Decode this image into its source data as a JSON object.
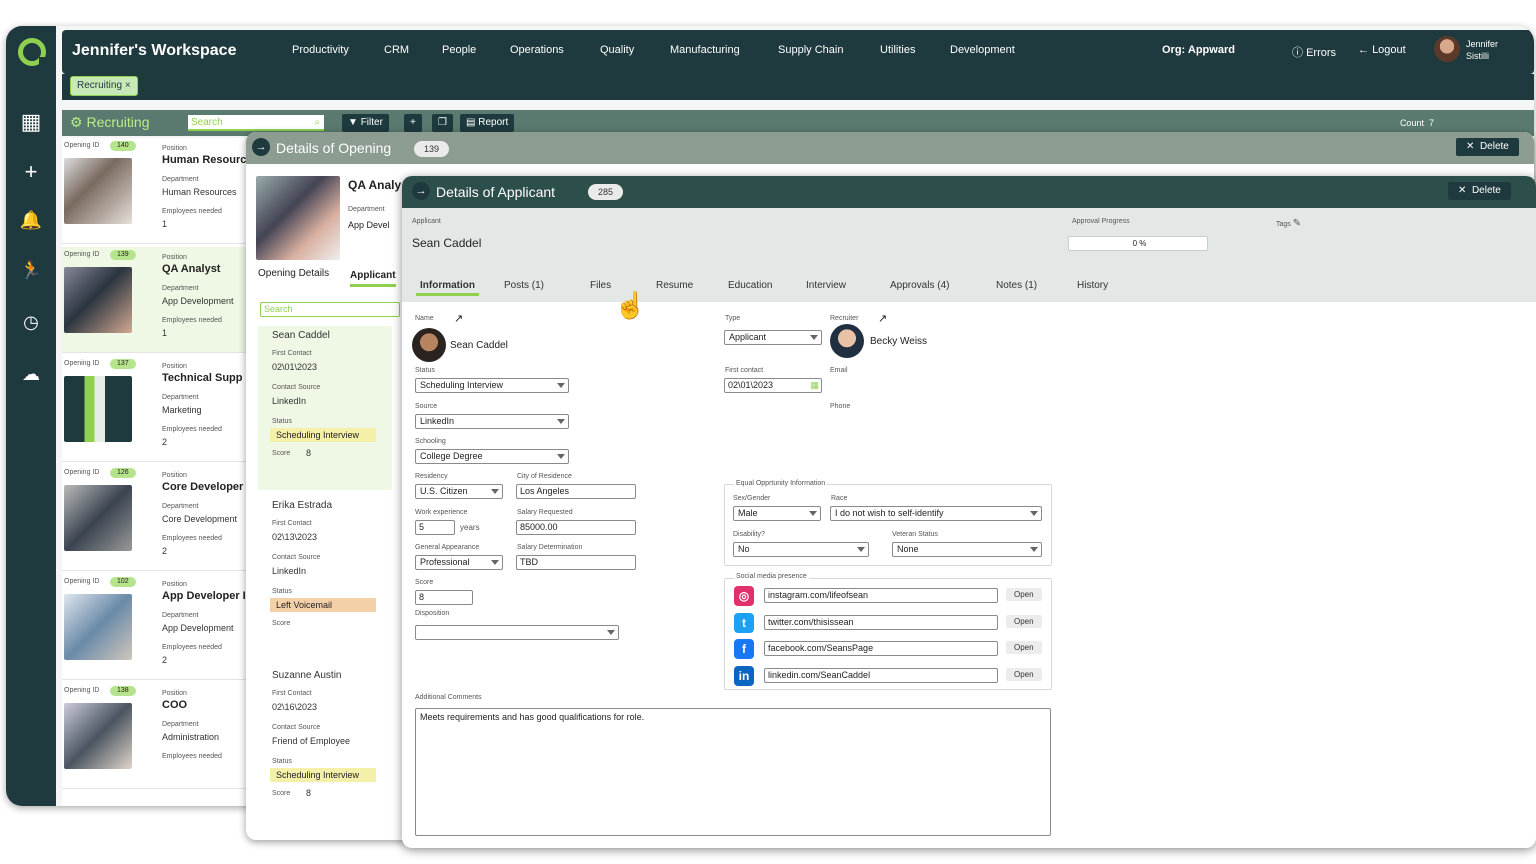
{
  "workspace_title": "Jennifer's Workspace",
  "nav": [
    "Productivity",
    "CRM",
    "People",
    "Operations",
    "Quality",
    "Manufacturing",
    "Supply Chain",
    "Utilities",
    "Development"
  ],
  "org_label": "Org:",
  "org_value": "Appward",
  "errors_label": "Errors",
  "logout_label": "Logout",
  "user": {
    "first": "Jennifer",
    "last": "Sistilli"
  },
  "chip_label": "Recruiting",
  "chip_close": "×",
  "list": {
    "title": "Recruiting",
    "search_placeholder": "Search",
    "filter_label": "Filter",
    "report_label": "Report",
    "count_label": "Count",
    "count_value": "7"
  },
  "openings_labels": {
    "opening_id": "Opening ID",
    "position": "Position",
    "department": "Department",
    "employees": "Employees needed"
  },
  "openings": [
    {
      "id": "140",
      "position": "Human Resourc",
      "department": "Human Resources",
      "employees": "1"
    },
    {
      "id": "139",
      "position": "QA Analyst",
      "department": "App Development",
      "employees": "1"
    },
    {
      "id": "137",
      "position": "Technical Supp",
      "department": "Marketing",
      "employees": "2"
    },
    {
      "id": "126",
      "position": "Core Developer",
      "department": "Core Development",
      "employees": "2"
    },
    {
      "id": "102",
      "position": "App Developer I",
      "department": "App Development",
      "employees": "2"
    },
    {
      "id": "138",
      "position": "COO",
      "department": "Administration",
      "employees": ""
    }
  ],
  "opening_details": {
    "title": "Details of Opening",
    "count": "139",
    "position": "QA Analy",
    "department_label": "Department",
    "department": "App Devel",
    "tab1": "Opening Details",
    "tab2": "Applicant",
    "search": "Search",
    "delete": "Delete"
  },
  "applicant_labels": {
    "first_contact": "First Contact",
    "contact_source": "Contact Source",
    "status": "Status",
    "score": "Score"
  },
  "applicants": [
    {
      "name": "Sean Caddel",
      "first_contact": "02\\01\\2023",
      "source": "LinkedIn",
      "status": "Scheduling Interview",
      "score": "8"
    },
    {
      "name": "Erika Estrada",
      "first_contact": "02\\13\\2023",
      "source": "LinkedIn",
      "status": "Left Voicemail",
      "score": ""
    },
    {
      "name": "Suzanne Austin",
      "first_contact": "02\\16\\2023",
      "source": "Friend of Employee",
      "status": "Scheduling Interview",
      "score": "8"
    }
  ],
  "applicant_details": {
    "title": "Details of Applicant",
    "count": "285",
    "delete": "Delete",
    "applicant_label": "Applicant",
    "applicant_name": "Sean Caddel",
    "approval_label": "Approval Progress",
    "approval_value": "0 %",
    "tags_label": "Tags",
    "tabs": [
      "Information",
      "Posts (1)",
      "Files",
      "Resume",
      "Education",
      "Interview",
      "Approvals (4)",
      "Notes (1)",
      "History"
    ],
    "name_label": "Name",
    "name": "Sean Caddel",
    "status_label": "Status",
    "status": "Scheduling Interview",
    "source_label": "Source",
    "source": "LinkedIn",
    "schooling_label": "Schooling",
    "schooling": "College Degree",
    "residency_label": "Residency",
    "residency": "U.S. Citizen",
    "city_label": "City of Residence",
    "city": "Los Angeles",
    "work_label": "Work experience",
    "work": "5",
    "years": "years",
    "salary_req_label": "Salary Requested",
    "salary_req": "85000.00",
    "appearance_label": "General Appearance",
    "appearance": "Professional",
    "salary_det_label": "Salary Determination",
    "salary_det": "TBD",
    "score_label": "Score",
    "score": "8",
    "disposition_label": "Disposition",
    "disposition": "",
    "type_label": "Type",
    "type": "Applicant",
    "first_contact_label": "First contact",
    "first_contact": "02\\01\\2023",
    "recruiter_label": "Recruiter",
    "recruiter": "Becky Weiss",
    "email_label": "Email",
    "phone_label": "Phone",
    "eeo_label": "Equal Opprtunity Information",
    "sex_label": "Sex/Gender",
    "sex": "Male",
    "race_label": "Race",
    "race": "I do not wish to self-identify",
    "disability_label": "Disability?",
    "disability": "No",
    "veteran_label": "Veteran Status",
    "veteran": "None",
    "social_label": "Social media presence",
    "social": [
      {
        "url": "instagram.com/lifeofsean",
        "color": "#e1306c",
        "glyph": "◎"
      },
      {
        "url": "twitter.com/thisissean",
        "color": "#1da1f2",
        "glyph": "t"
      },
      {
        "url": "facebook.com/SeansPage",
        "color": "#1877f2",
        "glyph": "f"
      },
      {
        "url": "linkedin.com/SeanCaddel",
        "color": "#0a66c2",
        "glyph": "in"
      }
    ],
    "open_label": "Open",
    "comments_label": "Additional Comments",
    "comments": "Meets requirements and has good qualifications for role."
  }
}
